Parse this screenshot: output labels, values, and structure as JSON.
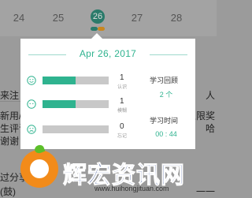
{
  "calendar": {
    "days": [
      "24",
      "25",
      "26",
      "27",
      "28"
    ],
    "selected_day": "26"
  },
  "background": {
    "left_lines": [
      "来注",
      "新用/",
      "生评论",
      "谢谢！",
      "过分享",
      "(鼓)"
    ],
    "right_lines": [
      "人",
      "上限奖",
      "哈",
      "一一"
    ]
  },
  "popup": {
    "date": "Apr 26, 2017",
    "rows": [
      {
        "icon": "happy-face-icon",
        "count": "1",
        "sub": "认识",
        "fill_percent": 50
      },
      {
        "icon": "neutral-face-icon",
        "count": "1",
        "sub": "模糊",
        "fill_percent": 50
      },
      {
        "icon": "sad-face-icon",
        "count": "0",
        "sub": "忘记",
        "fill_percent": 0
      }
    ],
    "review_label": "学习回顾",
    "review_value": "2 个",
    "time_label": "学习时间",
    "time_value": "00 : 44"
  },
  "watermark": {
    "title": "辉宏资讯网",
    "url": "www.huihongjituan.com"
  },
  "colors": {
    "accent": "#2fb38f",
    "bar_bg": "#c8c8c8",
    "watermark_blue": "#1f3a8a",
    "watermark_orange": "#f28b1a"
  }
}
